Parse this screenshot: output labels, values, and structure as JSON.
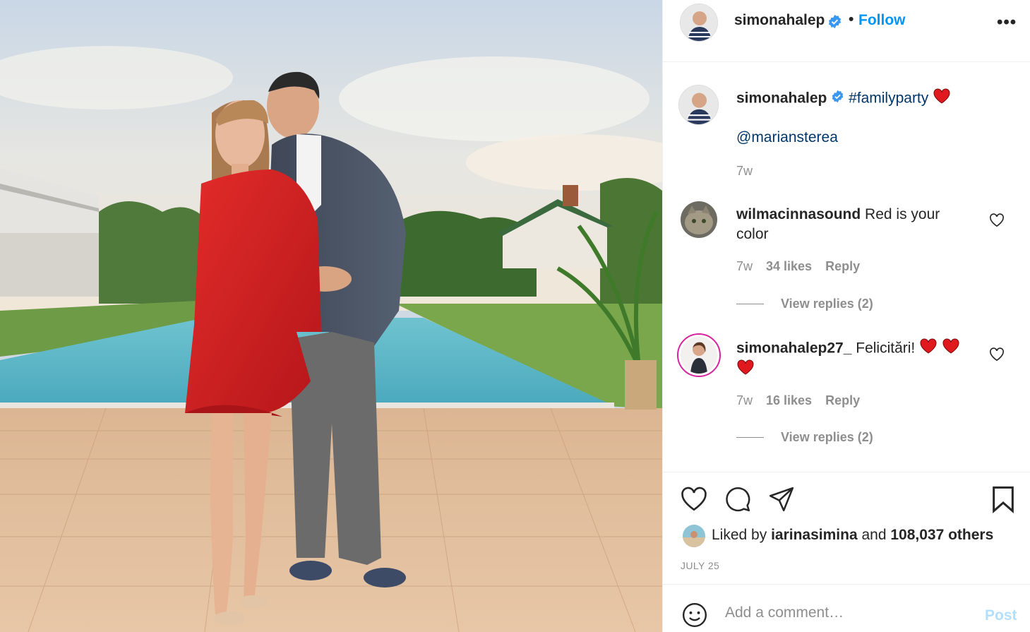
{
  "post": {
    "author": "simonahalep",
    "follow_label": "Follow",
    "dot": "•",
    "more_label": "•••"
  },
  "caption": {
    "author": "simonahalep",
    "hashtag": "#familyparty",
    "mention": "@mariansterea",
    "time": "7w"
  },
  "comments": [
    {
      "author": "wilmacinnasound",
      "text": "Red is your color",
      "time": "7w",
      "likes": "34 likes",
      "reply_label": "Reply",
      "view_replies": "View replies (2)"
    },
    {
      "author": "simonahalep27_",
      "text": "Felicitări!",
      "time": "7w",
      "likes": "16 likes",
      "reply_label": "Reply",
      "view_replies": "View replies (2)"
    }
  ],
  "likes": {
    "prefix": "Liked by",
    "user": "iarinasimina",
    "middle": "and",
    "others": "108,037 others"
  },
  "date": "JULY 25",
  "add_comment": {
    "placeholder": "Add a comment…",
    "post_label": "Post"
  },
  "colors": {
    "link_blue": "#0095f6",
    "tag_blue": "#00376b",
    "verified_blue": "#3897f0",
    "heart_red": "#ed4956",
    "post_disabled": "#b2dffc"
  },
  "icons": [
    "verified-badge-icon",
    "more-options-icon",
    "heart-icon",
    "comment-icon",
    "share-icon",
    "bookmark-icon",
    "emoji-icon",
    "red-heart-emoji"
  ]
}
